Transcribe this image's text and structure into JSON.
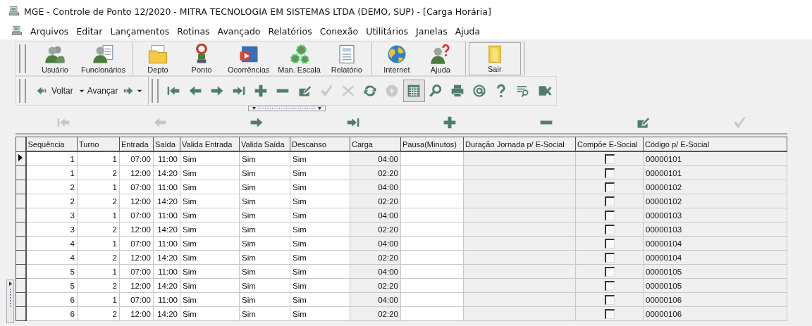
{
  "window": {
    "title": "MGE - Controle de Ponto 12/2020 - MITRA TECNOLOGIA EM SISTEMAS LTDA (DEMO, SUP) - [Carga Horária]"
  },
  "menu": [
    "Arquivos",
    "Editar",
    "Lançamentos",
    "Rotinas",
    "Avançado",
    "Relatórios",
    "Conexão",
    "Utilitários",
    "Janelas",
    "Ajuda"
  ],
  "main_toolbar": [
    [
      {
        "label": "Usuário",
        "kind": "users"
      },
      {
        "label": "Funcionários",
        "kind": "employees"
      }
    ],
    [
      {
        "label": "Depto",
        "kind": "folder"
      },
      {
        "label": "Ponto",
        "kind": "clock"
      },
      {
        "label": "Ocorrências",
        "kind": "occurrence"
      },
      {
        "label": "Man. Escala",
        "kind": "gears"
      },
      {
        "label": "Relatório",
        "kind": "report"
      }
    ],
    [
      {
        "label": "Internet",
        "kind": "globe"
      },
      {
        "label": "Ajuda",
        "kind": "help"
      }
    ],
    [
      {
        "label": "Sair",
        "kind": "exit"
      }
    ]
  ],
  "history": {
    "back": "Voltar",
    "forward": "Avançar"
  },
  "nav_toolbar": [
    {
      "kind": "first",
      "disabled": false
    },
    {
      "kind": "prev",
      "disabled": false
    },
    {
      "kind": "next",
      "disabled": false
    },
    {
      "kind": "last",
      "disabled": false
    },
    {
      "kind": "add",
      "disabled": false
    },
    {
      "kind": "remove",
      "disabled": false
    },
    {
      "kind": "edit",
      "disabled": false
    },
    {
      "kind": "confirm",
      "disabled": true
    },
    {
      "kind": "cancel",
      "disabled": true
    },
    {
      "kind": "refresh",
      "disabled": false
    },
    {
      "kind": "record",
      "disabled": true
    },
    {
      "kind": "calendar",
      "disabled": false,
      "pressed": true
    },
    {
      "kind": "search",
      "disabled": false
    },
    {
      "kind": "print",
      "disabled": false
    },
    {
      "kind": "email",
      "disabled": false
    },
    {
      "kind": "question",
      "disabled": false
    },
    {
      "kind": "filter",
      "disabled": false
    },
    {
      "kind": "excel",
      "disabled": false
    }
  ],
  "navigator": [
    {
      "kind": "first",
      "disabled": true
    },
    {
      "kind": "prev",
      "disabled": true
    },
    {
      "kind": "next",
      "disabled": false
    },
    {
      "kind": "last",
      "disabled": false
    },
    {
      "kind": "add",
      "disabled": false
    },
    {
      "kind": "remove",
      "disabled": false
    },
    {
      "kind": "edit",
      "disabled": false
    },
    {
      "kind": "confirm",
      "disabled": true
    }
  ],
  "table": {
    "columns": [
      "Sequência",
      "Turno",
      "Entrada",
      "Saída",
      "Valida Entrada",
      "Valida Saída",
      "Descanso",
      "Carga",
      "Pausa(Minutos)",
      "Duração Jornada p/ E-Social",
      "Compõe E-Social",
      "Código p/ E-Social"
    ],
    "rows": [
      {
        "current": true,
        "sequencia": "1",
        "turno": "1",
        "entrada": "07:00",
        "saida": "11:00",
        "valida_entrada": "Sim",
        "valida_saida": "Sim",
        "descanso": "Sim",
        "carga": "04:00",
        "compoe": false,
        "codigo": "00000101"
      },
      {
        "current": false,
        "sequencia": "1",
        "turno": "2",
        "entrada": "12:00",
        "saida": "14:20",
        "valida_entrada": "Sim",
        "valida_saida": "Sim",
        "descanso": "Sim",
        "carga": "02:20",
        "compoe": false,
        "codigo": "00000101"
      },
      {
        "current": false,
        "sequencia": "2",
        "turno": "1",
        "entrada": "07:00",
        "saida": "11:00",
        "valida_entrada": "Sim",
        "valida_saida": "Sim",
        "descanso": "Sim",
        "carga": "04:00",
        "compoe": false,
        "codigo": "00000102"
      },
      {
        "current": false,
        "sequencia": "2",
        "turno": "2",
        "entrada": "12:00",
        "saida": "14:20",
        "valida_entrada": "Sim",
        "valida_saida": "Sim",
        "descanso": "Sim",
        "carga": "02:20",
        "compoe": false,
        "codigo": "00000102"
      },
      {
        "current": false,
        "sequencia": "3",
        "turno": "1",
        "entrada": "07:00",
        "saida": "11:00",
        "valida_entrada": "Sim",
        "valida_saida": "Sim",
        "descanso": "Sim",
        "carga": "04:00",
        "compoe": false,
        "codigo": "00000103"
      },
      {
        "current": false,
        "sequencia": "3",
        "turno": "2",
        "entrada": "12:00",
        "saida": "14:20",
        "valida_entrada": "Sim",
        "valida_saida": "Sim",
        "descanso": "Sim",
        "carga": "02:20",
        "compoe": false,
        "codigo": "00000103"
      },
      {
        "current": false,
        "sequencia": "4",
        "turno": "1",
        "entrada": "07:00",
        "saida": "11:00",
        "valida_entrada": "Sim",
        "valida_saida": "Sim",
        "descanso": "Sim",
        "carga": "04:00",
        "compoe": false,
        "codigo": "00000104"
      },
      {
        "current": false,
        "sequencia": "4",
        "turno": "2",
        "entrada": "12:00",
        "saida": "14:20",
        "valida_entrada": "Sim",
        "valida_saida": "Sim",
        "descanso": "Sim",
        "carga": "02:20",
        "compoe": false,
        "codigo": "00000104"
      },
      {
        "current": false,
        "sequencia": "5",
        "turno": "1",
        "entrada": "07:00",
        "saida": "11:00",
        "valida_entrada": "Sim",
        "valida_saida": "Sim",
        "descanso": "Sim",
        "carga": "04:00",
        "compoe": false,
        "codigo": "00000105"
      },
      {
        "current": false,
        "sequencia": "5",
        "turno": "2",
        "entrada": "12:00",
        "saida": "14:20",
        "valida_entrada": "Sim",
        "valida_saida": "Sim",
        "descanso": "Sim",
        "carga": "02:20",
        "compoe": false,
        "codigo": "00000105"
      },
      {
        "current": false,
        "sequencia": "6",
        "turno": "1",
        "entrada": "07:00",
        "saida": "11:00",
        "valida_entrada": "Sim",
        "valida_saida": "Sim",
        "descanso": "Sim",
        "carga": "04:00",
        "compoe": false,
        "codigo": "00000106"
      },
      {
        "current": false,
        "sequencia": "6",
        "turno": "2",
        "entrada": "12:00",
        "saida": "14:20",
        "valida_entrada": "Sim",
        "valida_saida": "Sim",
        "descanso": "Sim",
        "carga": "02:20",
        "compoe": false,
        "codigo": "00000106"
      }
    ]
  }
}
